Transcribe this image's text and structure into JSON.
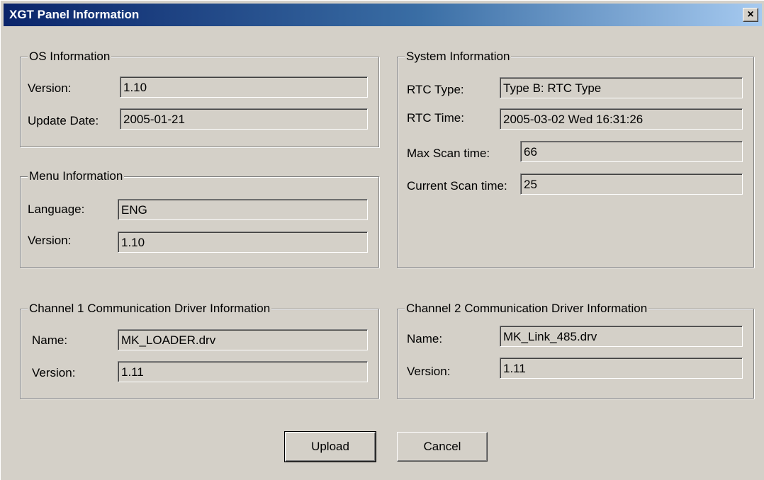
{
  "window": {
    "title": "XGT Panel Information",
    "close_label": "×"
  },
  "os_info": {
    "legend": "OS Information",
    "version_label": "Version:",
    "version_value": "1.10",
    "update_label": "Update Date:",
    "update_value": "2005-01-21"
  },
  "menu_info": {
    "legend": "Menu Information",
    "language_label": "Language:",
    "language_value": "ENG",
    "version_label": "Version:",
    "version_value": "1.10"
  },
  "system_info": {
    "legend": "System Information",
    "rtc_type_label": "RTC Type:",
    "rtc_type_value": "Type B: RTC Type",
    "rtc_time_label": "RTC Time:",
    "rtc_time_value": "2005-03-02 Wed 16:31:26",
    "max_scan_label": "Max Scan time:",
    "max_scan_value": "66",
    "current_scan_label": "Current Scan time:",
    "current_scan_value": "25"
  },
  "channel1": {
    "legend": "Channel 1 Communication Driver Information",
    "name_label": "Name:",
    "name_value": "MK_LOADER.drv",
    "version_label": "Version:",
    "version_value": "1.11"
  },
  "channel2": {
    "legend": "Channel 2 Communication Driver Information",
    "name_label": "Name:",
    "name_value": "MK_Link_485.drv",
    "version_label": "Version:",
    "version_value": "1.11"
  },
  "buttons": {
    "upload": "Upload",
    "cancel": "Cancel"
  }
}
